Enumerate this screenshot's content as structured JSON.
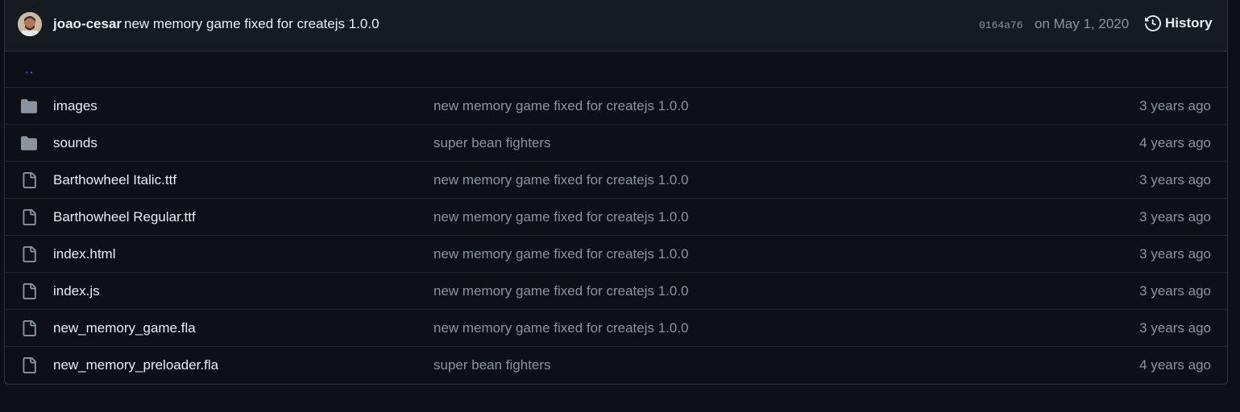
{
  "commit": {
    "author": "joao-cesar",
    "message": "new memory game fixed for createjs 1.0.0",
    "sha": "0164a76",
    "date": "on May 1, 2020",
    "history_label": "History"
  },
  "parent_dir_label": "..",
  "colors": {
    "background": "#0d1117",
    "header_bg": "#161b22",
    "border": "#30363d",
    "text": "#e6edf3",
    "muted": "#8b949e",
    "link": "#2f81f7",
    "folder_icon": "#8b949e"
  },
  "files": [
    {
      "type": "folder",
      "icon": "folder-icon",
      "name": "images",
      "message": "new memory game fixed for createjs 1.0.0",
      "age": "3 years ago"
    },
    {
      "type": "folder",
      "icon": "folder-icon",
      "name": "sounds",
      "message": "super bean fighters",
      "age": "4 years ago"
    },
    {
      "type": "file",
      "icon": "file-icon",
      "name": "Barthowheel Italic.ttf",
      "message": "new memory game fixed for createjs 1.0.0",
      "age": "3 years ago"
    },
    {
      "type": "file",
      "icon": "file-icon",
      "name": "Barthowheel Regular.ttf",
      "message": "new memory game fixed for createjs 1.0.0",
      "age": "3 years ago"
    },
    {
      "type": "file",
      "icon": "file-icon",
      "name": "index.html",
      "message": "new memory game fixed for createjs 1.0.0",
      "age": "3 years ago"
    },
    {
      "type": "file",
      "icon": "file-icon",
      "name": "index.js",
      "message": "new memory game fixed for createjs 1.0.0",
      "age": "3 years ago"
    },
    {
      "type": "file",
      "icon": "file-icon",
      "name": "new_memory_game.fla",
      "message": "new memory game fixed for createjs 1.0.0",
      "age": "3 years ago"
    },
    {
      "type": "file",
      "icon": "file-icon",
      "name": "new_memory_preloader.fla",
      "message": "super bean fighters",
      "age": "4 years ago"
    }
  ]
}
